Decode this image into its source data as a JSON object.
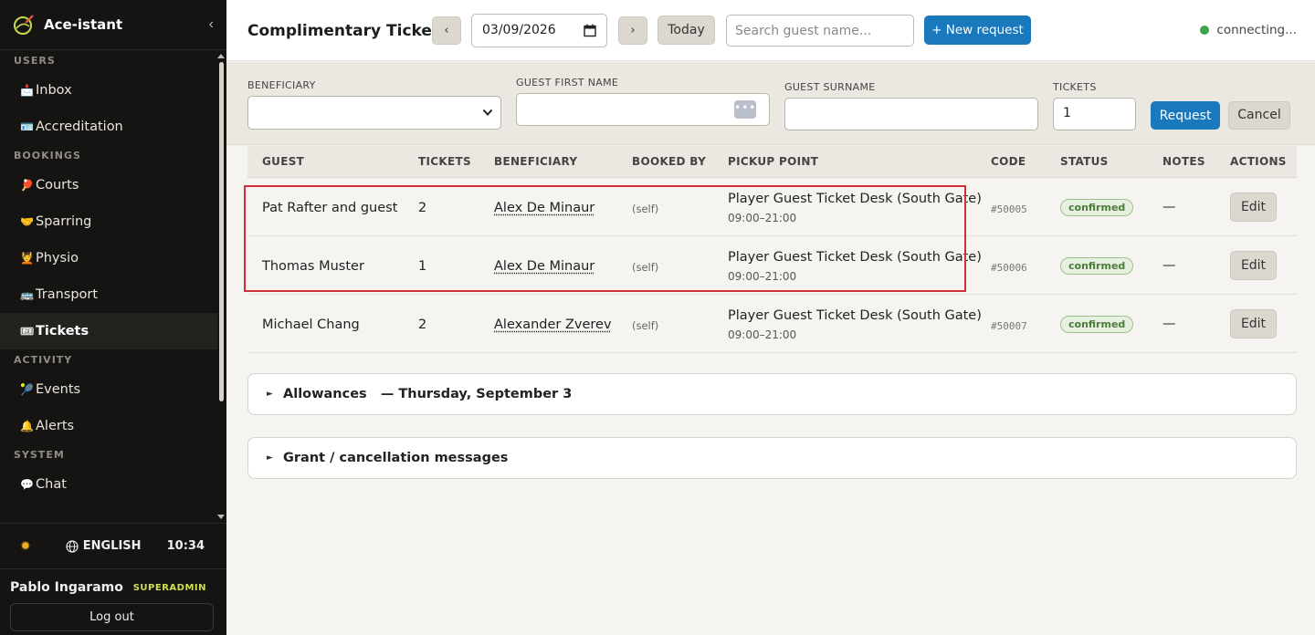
{
  "app": {
    "title": "Ace-istant"
  },
  "sidebar": {
    "sections": [
      {
        "label": "USERS",
        "items": [
          {
            "label": "Inbox",
            "icon": "📩"
          },
          {
            "label": "Accreditation",
            "icon": "🪪"
          }
        ]
      },
      {
        "label": "BOOKINGS",
        "items": [
          {
            "label": "Courts",
            "icon": "🏓"
          },
          {
            "label": "Sparring",
            "icon": "🤝"
          },
          {
            "label": "Physio",
            "icon": "💆"
          },
          {
            "label": "Transport",
            "icon": "🚌"
          },
          {
            "label": "Tickets",
            "icon": "🎟"
          }
        ]
      },
      {
        "label": "ACTIVITY",
        "items": [
          {
            "label": "Events",
            "icon": "🎾"
          },
          {
            "label": "Alerts",
            "icon": "🔔"
          }
        ]
      },
      {
        "label": "SYSTEM",
        "items": [
          {
            "label": "Chat",
            "icon": "💬"
          }
        ]
      }
    ],
    "active_item": "Tickets",
    "language": "ENGLISH",
    "time": "10:34",
    "user": {
      "name": "Pablo Ingaramo",
      "role": "SUPERADMIN"
    },
    "logout_label": "Log out"
  },
  "header": {
    "title": "Complimentary Tickets",
    "prev_label": "‹",
    "next_label": "›",
    "date_value": "03/09/2026",
    "today_label": "Today",
    "search_placeholder": "Search guest name...",
    "new_request_label": "+ New request",
    "connection_status": "connecting..."
  },
  "form": {
    "beneficiary_label": "BENEFICIARY",
    "first_name_label": "GUEST FIRST NAME",
    "surname_label": "GUEST SURNAME",
    "tickets_label": "TICKETS",
    "tickets_value": "1",
    "request_label": "Request",
    "cancel_label": "Cancel"
  },
  "table": {
    "headers": {
      "guest": "GUEST",
      "tickets": "TICKETS",
      "beneficiary": "BENEFICIARY",
      "booked_by": "BOOKED BY",
      "pickup": "PICKUP POINT",
      "code": "CODE",
      "status": "STATUS",
      "notes": "NOTES",
      "actions": "ACTIONS"
    },
    "rows": [
      {
        "guest": "Pat Rafter and guest",
        "tickets": "2",
        "beneficiary": "Alex De Minaur",
        "booked_by": "(self)",
        "pickup": "Player Guest Ticket Desk (South Gate)",
        "pickup_hours": "09:00–21:00",
        "code": "#50005",
        "status": "confirmed",
        "notes": "—",
        "action": "Edit"
      },
      {
        "guest": "Thomas Muster",
        "tickets": "1",
        "beneficiary": "Alex De Minaur",
        "booked_by": "(self)",
        "pickup": "Player Guest Ticket Desk (South Gate)",
        "pickup_hours": "09:00–21:00",
        "code": "#50006",
        "status": "confirmed",
        "notes": "—",
        "action": "Edit"
      },
      {
        "guest": "Michael Chang",
        "tickets": "2",
        "beneficiary": "Alexander Zverev",
        "booked_by": "(self)",
        "pickup": "Player Guest Ticket Desk (South Gate)",
        "pickup_hours": "09:00–21:00",
        "code": "#50007",
        "status": "confirmed",
        "notes": "—",
        "action": "Edit"
      }
    ]
  },
  "allowances": {
    "label": "Allowances",
    "date": "— Thursday, September 3"
  },
  "messages": {
    "label": "Grant / cancellation messages"
  },
  "colors": {
    "accent": "#1a78bd",
    "sidebar_bg": "#151412",
    "status_ok": "#3ba34a",
    "highlight": "#d0303a"
  }
}
